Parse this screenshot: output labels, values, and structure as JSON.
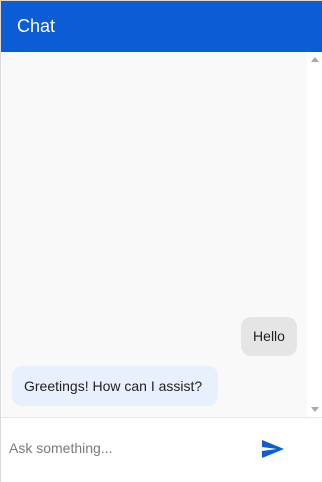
{
  "header": {
    "title": "Chat"
  },
  "messages": [
    {
      "sender": "user",
      "text": "Hello"
    },
    {
      "sender": "bot",
      "text": "Greetings! How can I assist?"
    }
  ],
  "composer": {
    "placeholder": "Ask something...",
    "value": "",
    "send_icon": "send-icon"
  },
  "colors": {
    "header_bg": "#0b5cd5",
    "user_bubble": "#e4e5e4",
    "bot_bubble": "#e9f0fd",
    "accent": "#0b5cd5"
  }
}
